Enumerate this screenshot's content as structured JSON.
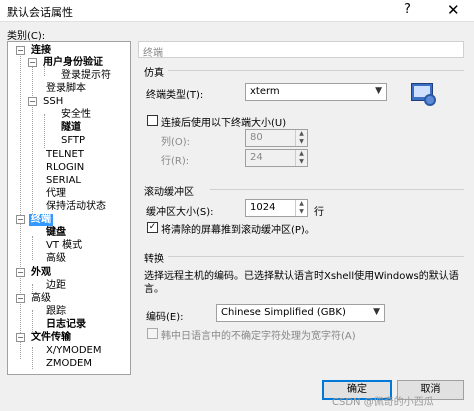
{
  "window": {
    "title": "默认会话属性",
    "help": "?",
    "close": "✕"
  },
  "category_label": "类别(C):",
  "tree": [
    {
      "label": "连接",
      "toggle": "−"
    },
    {
      "label": "用户身份验证",
      "toggle": "−"
    },
    {
      "label": "登录提示符"
    },
    {
      "label": "登录脚本"
    },
    {
      "label": "SSH",
      "toggle": "−"
    },
    {
      "label": "安全性"
    },
    {
      "label": "隧道"
    },
    {
      "label": "SFTP"
    },
    {
      "label": "TELNET"
    },
    {
      "label": "RLOGIN"
    },
    {
      "label": "SERIAL"
    },
    {
      "label": "代理"
    },
    {
      "label": "保持活动状态"
    },
    {
      "label": "终端",
      "toggle": "−"
    },
    {
      "label": "键盘"
    },
    {
      "label": "VT 模式"
    },
    {
      "label": "高级"
    },
    {
      "label": "外观",
      "toggle": "−"
    },
    {
      "label": "边距"
    },
    {
      "label": "高级",
      "toggle": "−"
    },
    {
      "label": "跟踪"
    },
    {
      "label": "日志记录"
    },
    {
      "label": "文件传输",
      "toggle": "−"
    },
    {
      "label": "X/YMODEM"
    },
    {
      "label": "ZMODEM"
    }
  ],
  "page_title": "终端",
  "emulation": {
    "group": "仿真",
    "type_label": "终端类型(T):",
    "type_value": "xterm",
    "size_checkbox": "连接后使用以下终端大小(U)",
    "cols_label": "列(O):",
    "cols_value": "80",
    "rows_label": "行(R):",
    "rows_value": "24",
    "icon": "terminal-settings-icon"
  },
  "scrollback": {
    "group": "滚动缓冲区",
    "size_label": "缓冲区大小(S):",
    "size_value": "1024",
    "unit": "行",
    "push_checkbox": "将清除的屏幕推到滚动缓冲区(P)。",
    "push_checked": "✓"
  },
  "translation": {
    "group": "转换",
    "description_line1": "选择远程主机的编码。已选择默认语言时Xshell使用Windows的默认语",
    "description_line2": "言。",
    "encoding_label": "编码(E):",
    "encoding_value": "Chinese Simplified (GBK)",
    "cjk_checkbox": "韩中日语言中的不确定字符处理为宽字符(A)"
  },
  "buttons": {
    "ok": "确定",
    "cancel": "取消"
  },
  "watermark": "CSDN @佩奇的小西瓜"
}
